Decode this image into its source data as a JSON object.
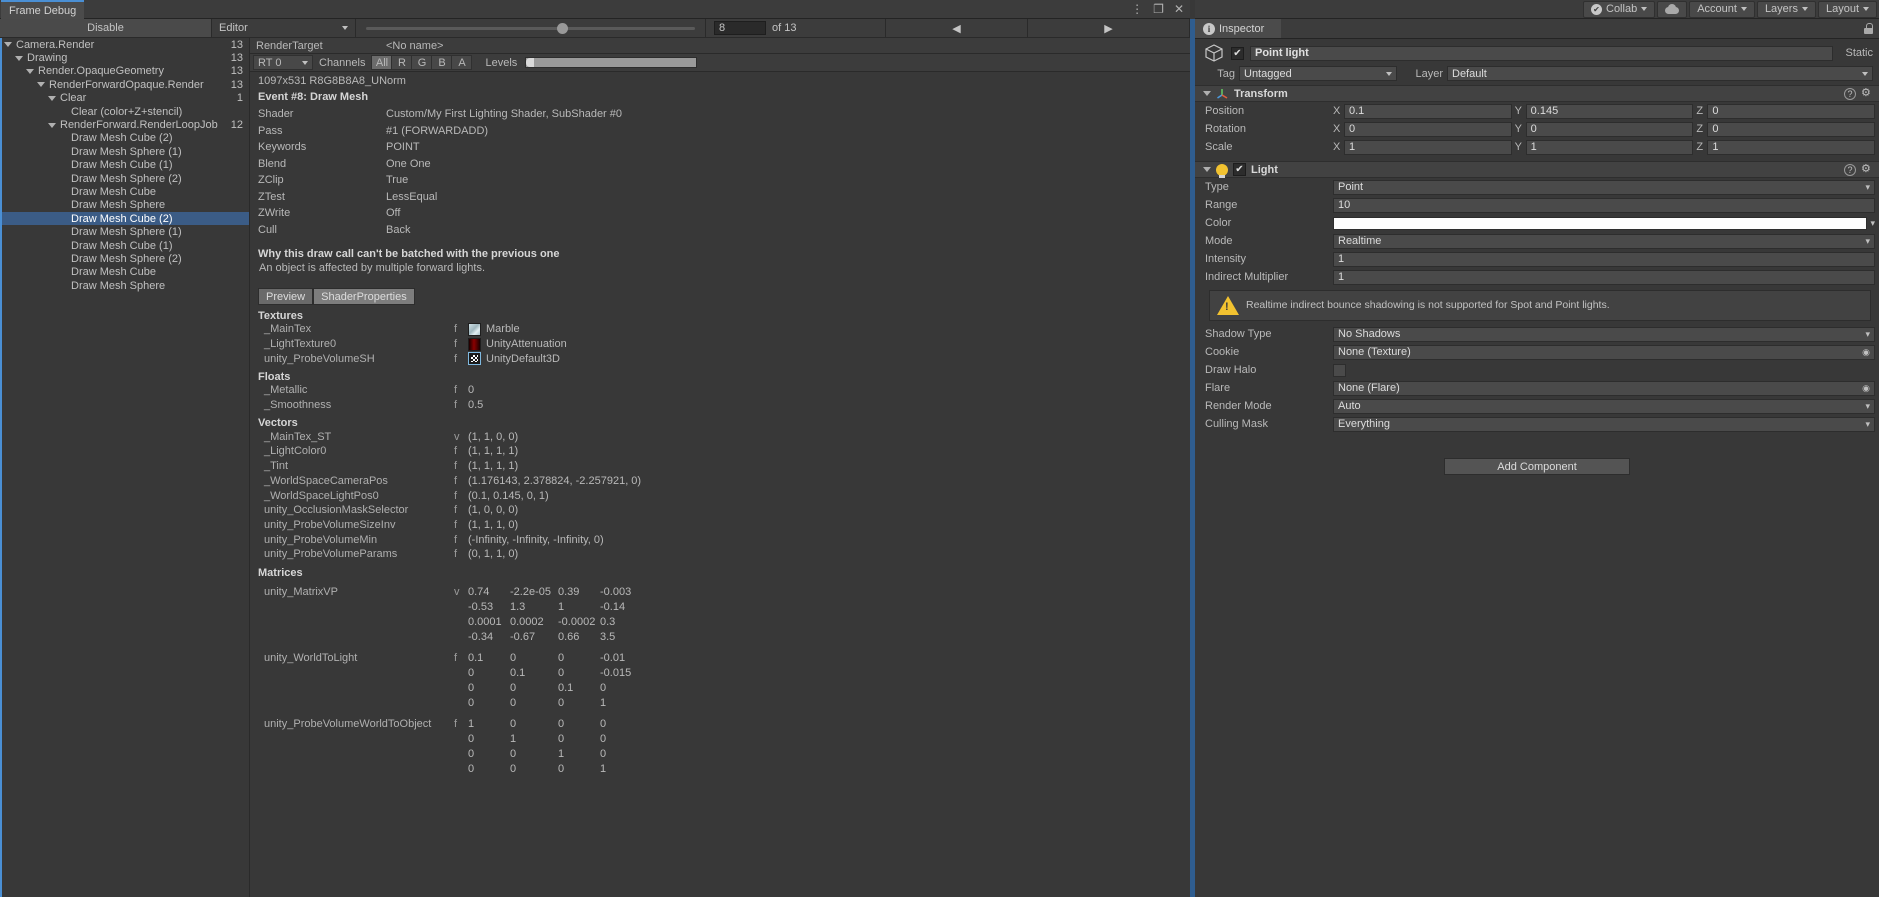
{
  "unity_toolbar": {
    "collab": "Collab",
    "cloud_icon": "cloud-icon",
    "account": "Account",
    "layers": "Layers",
    "layout": "Layout"
  },
  "frame_debugger": {
    "tab_title": "Frame Debug",
    "toolbar": {
      "disable_label": "Disable",
      "editor_label": "Editor",
      "event_number": "8",
      "of_label": "of 13",
      "prev_arrow": "◀",
      "next_arrow": "▶"
    },
    "tree": [
      {
        "label": "Camera.Render",
        "depth": 0,
        "count": "13",
        "expandable": true,
        "selected": false
      },
      {
        "label": "Drawing",
        "depth": 1,
        "count": "13",
        "expandable": true,
        "selected": false
      },
      {
        "label": "Render.OpaqueGeometry",
        "depth": 2,
        "count": "13",
        "expandable": true,
        "selected": false
      },
      {
        "label": "RenderForwardOpaque.Render",
        "depth": 3,
        "count": "13",
        "expandable": true,
        "selected": false
      },
      {
        "label": "Clear",
        "depth": 4,
        "count": "1",
        "expandable": true,
        "selected": false
      },
      {
        "label": "Clear (color+Z+stencil)",
        "depth": 5,
        "count": "",
        "expandable": false,
        "selected": false
      },
      {
        "label": "RenderForward.RenderLoopJob",
        "depth": 4,
        "count": "12",
        "expandable": true,
        "selected": false
      },
      {
        "label": "Draw Mesh Cube (2)",
        "depth": 5,
        "count": "",
        "expandable": false,
        "selected": false
      },
      {
        "label": "Draw Mesh Sphere (1)",
        "depth": 5,
        "count": "",
        "expandable": false,
        "selected": false
      },
      {
        "label": "Draw Mesh Cube (1)",
        "depth": 5,
        "count": "",
        "expandable": false,
        "selected": false
      },
      {
        "label": "Draw Mesh Sphere (2)",
        "depth": 5,
        "count": "",
        "expandable": false,
        "selected": false
      },
      {
        "label": "Draw Mesh Cube",
        "depth": 5,
        "count": "",
        "expandable": false,
        "selected": false
      },
      {
        "label": "Draw Mesh Sphere",
        "depth": 5,
        "count": "",
        "expandable": false,
        "selected": false
      },
      {
        "label": "Draw Mesh Cube (2)",
        "depth": 5,
        "count": "",
        "expandable": false,
        "selected": true
      },
      {
        "label": "Draw Mesh Sphere (1)",
        "depth": 5,
        "count": "",
        "expandable": false,
        "selected": false
      },
      {
        "label": "Draw Mesh Cube (1)",
        "depth": 5,
        "count": "",
        "expandable": false,
        "selected": false
      },
      {
        "label": "Draw Mesh Sphere (2)",
        "depth": 5,
        "count": "",
        "expandable": false,
        "selected": false
      },
      {
        "label": "Draw Mesh Cube",
        "depth": 5,
        "count": "",
        "expandable": false,
        "selected": false
      },
      {
        "label": "Draw Mesh Sphere",
        "depth": 5,
        "count": "",
        "expandable": false,
        "selected": false
      }
    ],
    "detail": {
      "rendertarget_label": "RenderTarget",
      "rendertarget_name": "<No name>",
      "rt_select": "RT 0",
      "channels_label": "Channels",
      "channel_buttons": [
        "All",
        "R",
        "G",
        "B",
        "A"
      ],
      "channel_active": "All",
      "levels_label": "Levels",
      "rt_info": "1097x531 R8G8B8A8_UNorm",
      "event_title": "Event #8: Draw Mesh",
      "state_rows": [
        {
          "key": "Shader",
          "value": "Custom/My First Lighting Shader, SubShader #0"
        },
        {
          "key": "Pass",
          "value": "#1 (FORWARDADD)"
        },
        {
          "key": "Keywords",
          "value": "POINT"
        },
        {
          "key": "Blend",
          "value": "One One"
        },
        {
          "key": "ZClip",
          "value": "True"
        },
        {
          "key": "ZTest",
          "value": "LessEqual"
        },
        {
          "key": "ZWrite",
          "value": "Off"
        },
        {
          "key": "Cull",
          "value": "Back"
        }
      ],
      "batch_title": "Why this draw call can't be batched with the previous one",
      "batch_reason": "An object is affected by multiple forward lights.",
      "tabs": [
        {
          "label": "Preview",
          "active": false
        },
        {
          "label": "ShaderProperties",
          "active": true
        }
      ],
      "textures_title": "Textures",
      "textures": [
        {
          "name": "_MainTex",
          "type": "f",
          "value": "Marble",
          "swatch": "sw-marble"
        },
        {
          "name": "_LightTexture0",
          "type": "f",
          "value": "UnityAttenuation",
          "swatch": "sw-atten"
        },
        {
          "name": "unity_ProbeVolumeSH",
          "type": "f",
          "value": "UnityDefault3D",
          "swatch": "sw-default3d"
        }
      ],
      "floats_title": "Floats",
      "floats": [
        {
          "name": "_Metallic",
          "type": "f",
          "value": "0"
        },
        {
          "name": "_Smoothness",
          "type": "f",
          "value": "0.5"
        }
      ],
      "vectors_title": "Vectors",
      "vectors": [
        {
          "name": "_MainTex_ST",
          "type": "v",
          "value": "(1, 1, 0, 0)"
        },
        {
          "name": "_LightColor0",
          "type": "f",
          "value": "(1, 1, 1, 1)"
        },
        {
          "name": "_Tint",
          "type": "f",
          "value": "(1, 1, 1, 1)"
        },
        {
          "name": "_WorldSpaceCameraPos",
          "type": "f",
          "value": "(1.176143, 2.378824, -2.257921, 0)"
        },
        {
          "name": "_WorldSpaceLightPos0",
          "type": "f",
          "value": "(0.1, 0.145, 0, 1)"
        },
        {
          "name": "unity_OcclusionMaskSelector",
          "type": "f",
          "value": "(1, 0, 0, 0)"
        },
        {
          "name": "unity_ProbeVolumeSizeInv",
          "type": "f",
          "value": "(1, 1, 1, 0)"
        },
        {
          "name": "unity_ProbeVolumeMin",
          "type": "f",
          "value": "(-Infinity, -Infinity, -Infinity, 0)"
        },
        {
          "name": "unity_ProbeVolumeParams",
          "type": "f",
          "value": "(0, 1, 1, 0)"
        }
      ],
      "matrices_title": "Matrices",
      "matrices": [
        {
          "name": "unity_MatrixVP",
          "type": "v",
          "rows": [
            [
              "0.74",
              "-2.2e-05",
              "0.39",
              "-0.003"
            ],
            [
              "-0.53",
              "1.3",
              "1",
              "-0.14"
            ],
            [
              "0.0001",
              "0.0002",
              "-0.0002",
              "0.3"
            ],
            [
              "-0.34",
              "-0.67",
              "0.66",
              "3.5"
            ]
          ]
        },
        {
          "name": "unity_WorldToLight",
          "type": "f",
          "rows": [
            [
              "0.1",
              "0",
              "0",
              "-0.01"
            ],
            [
              "0",
              "0.1",
              "0",
              "-0.015"
            ],
            [
              "0",
              "0",
              "0.1",
              "0"
            ],
            [
              "0",
              "0",
              "0",
              "1"
            ]
          ]
        },
        {
          "name": "unity_ProbeVolumeWorldToObject",
          "type": "f",
          "rows": [
            [
              "1",
              "0",
              "0",
              "0"
            ],
            [
              "0",
              "1",
              "0",
              "0"
            ],
            [
              "0",
              "0",
              "1",
              "0"
            ],
            [
              "0",
              "0",
              "0",
              "1"
            ]
          ]
        }
      ]
    }
  },
  "inspector": {
    "tab_label": "Inspector",
    "object_name": "Point light",
    "static_label": "Static",
    "tag_label": "Tag",
    "tag_value": "Untagged",
    "layer_label": "Layer",
    "layer_value": "Default",
    "transform": {
      "title": "Transform",
      "position_label": "Position",
      "position": {
        "x": "0.1",
        "y": "0.145",
        "z": "0"
      },
      "rotation_label": "Rotation",
      "rotation": {
        "x": "0",
        "y": "0",
        "z": "0"
      },
      "scale_label": "Scale",
      "scale": {
        "x": "1",
        "y": "1",
        "z": "1"
      }
    },
    "light": {
      "title": "Light",
      "type_label": "Type",
      "type_value": "Point",
      "range_label": "Range",
      "range_value": "10",
      "color_label": "Color",
      "color_value": "#FDFDFD",
      "mode_label": "Mode",
      "mode_value": "Realtime",
      "intensity_label": "Intensity",
      "intensity_value": "1",
      "indirect_label": "Indirect Multiplier",
      "indirect_value": "1",
      "warning": "Realtime indirect bounce shadowing is not supported for Spot and Point lights.",
      "shadow_label": "Shadow Type",
      "shadow_value": "No Shadows",
      "cookie_label": "Cookie",
      "cookie_value": "None (Texture)",
      "halo_label": "Draw Halo",
      "flare_label": "Flare",
      "flare_value": "None (Flare)",
      "rendermode_label": "Render Mode",
      "rendermode_value": "Auto",
      "culling_label": "Culling Mask",
      "culling_value": "Everything"
    },
    "add_component": "Add Component"
  }
}
